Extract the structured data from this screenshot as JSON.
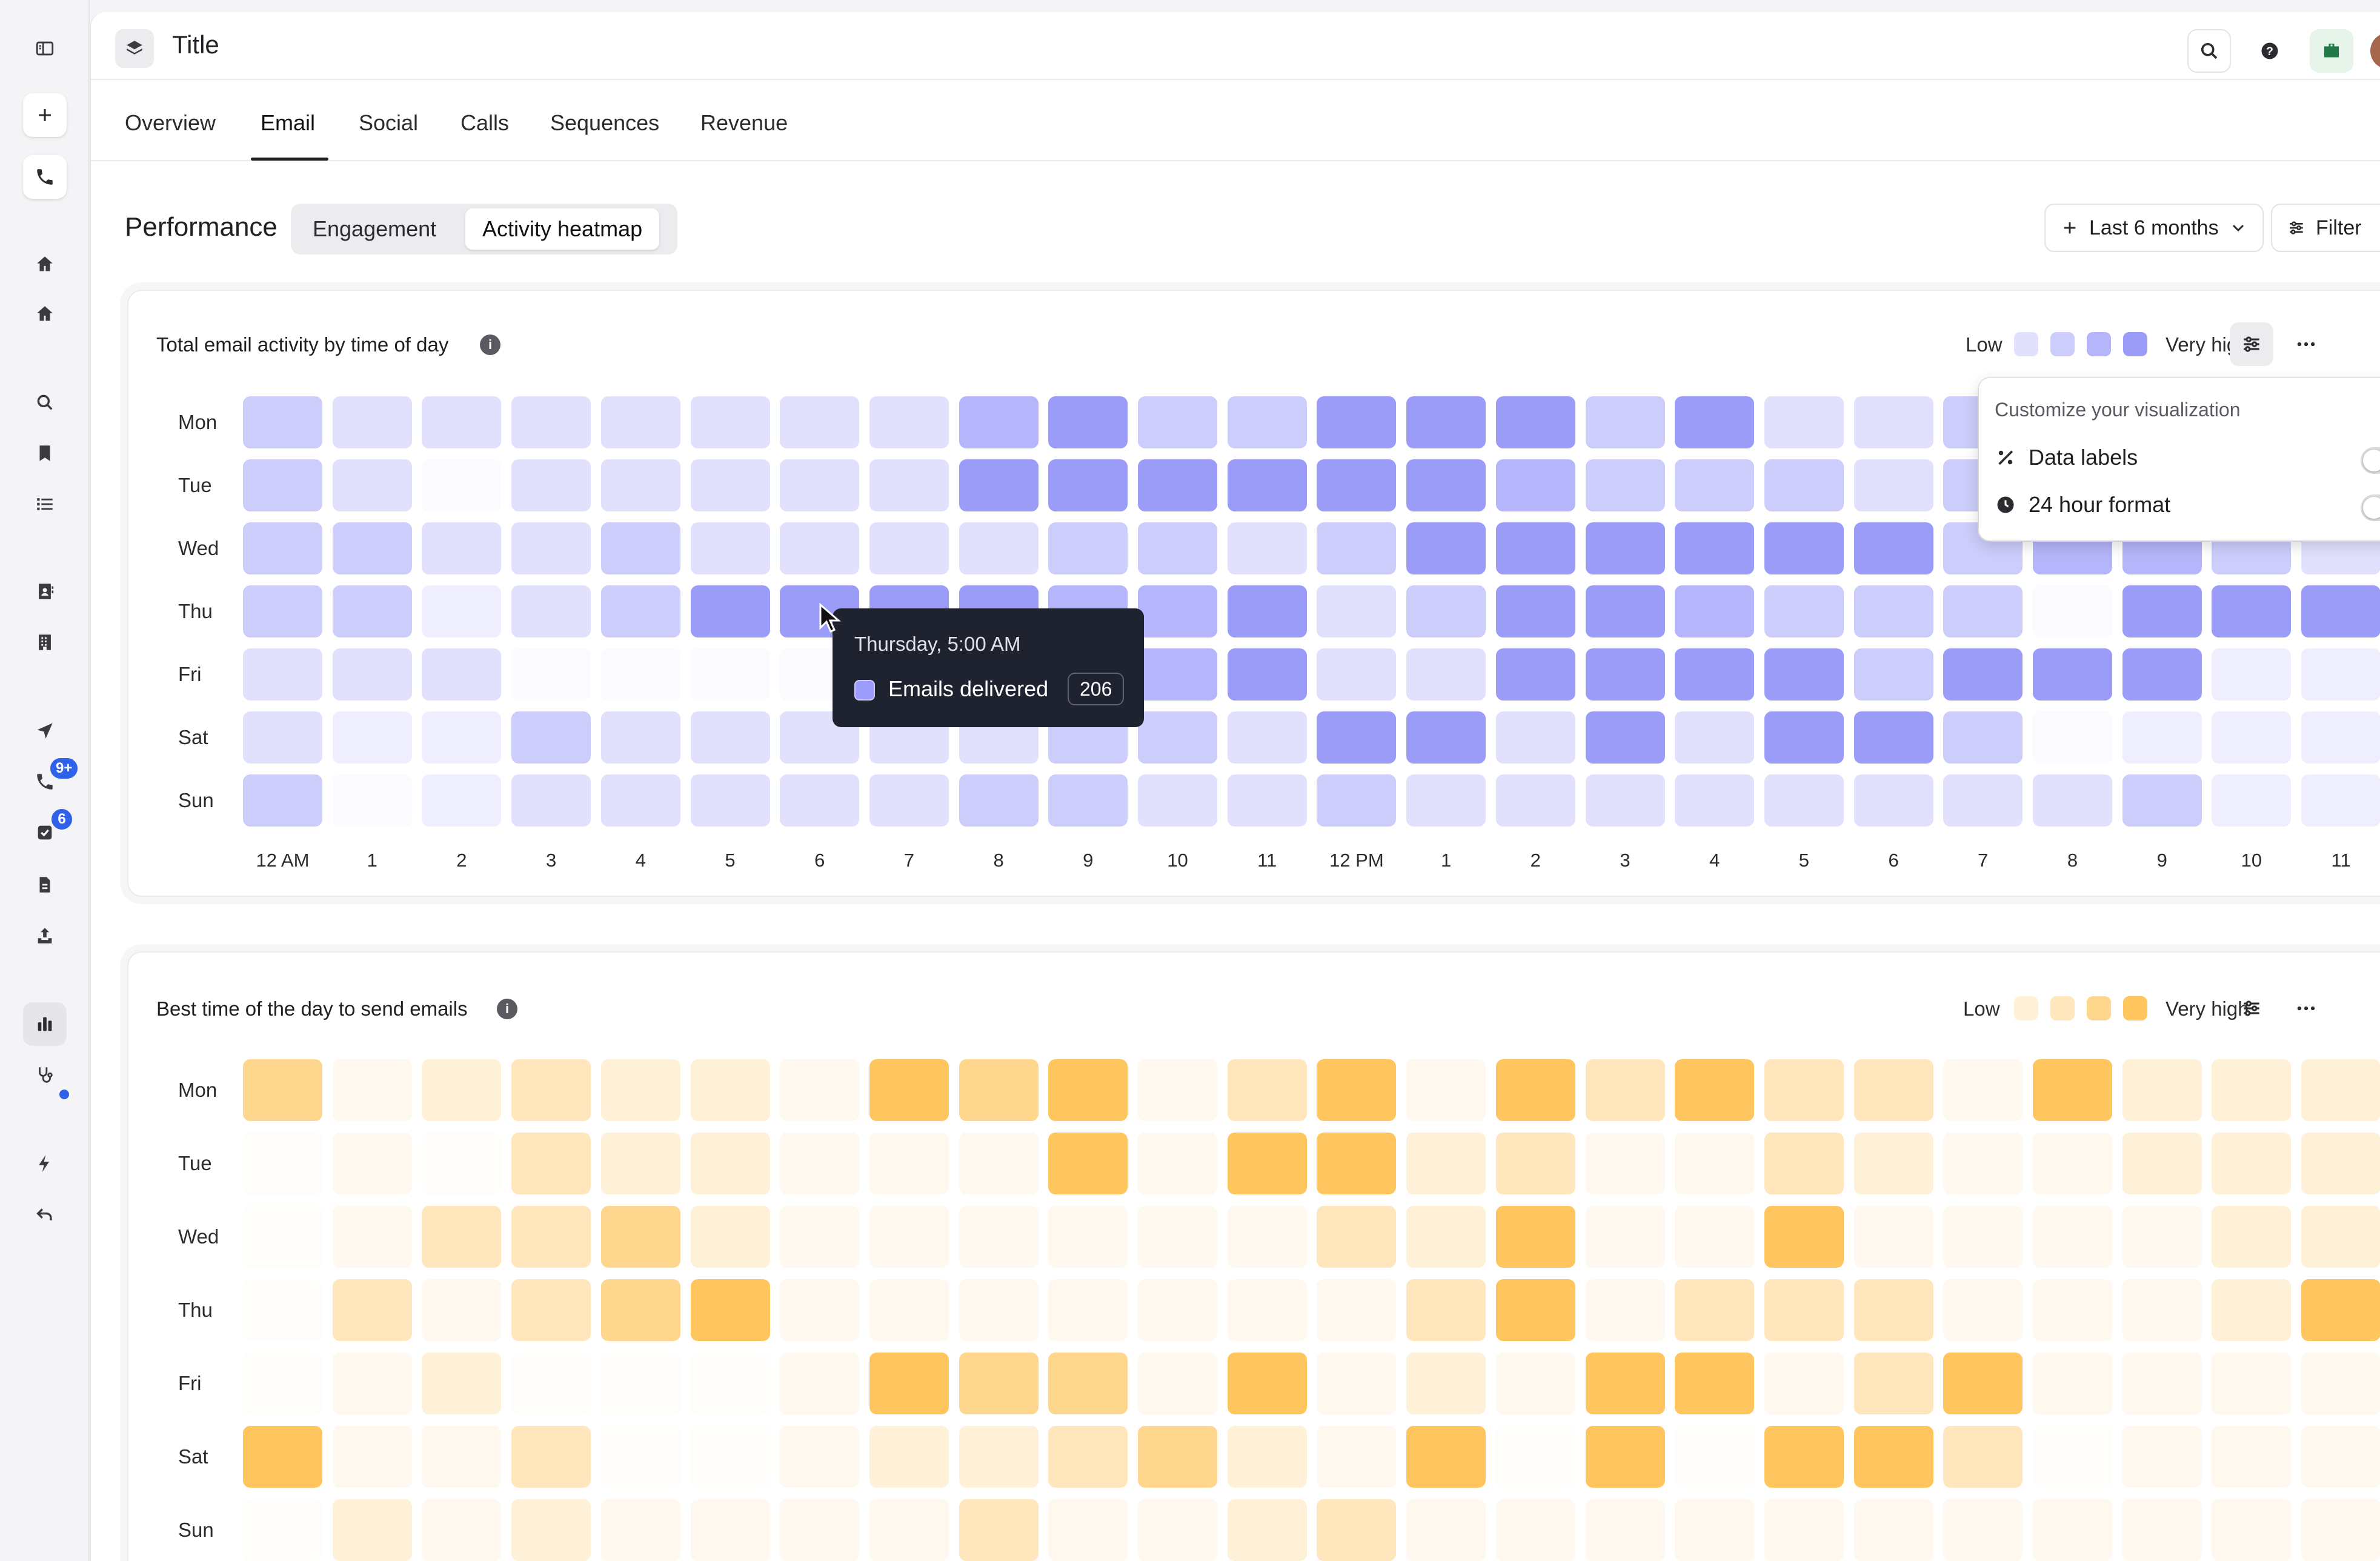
{
  "app": {
    "title": "Title"
  },
  "rail": {
    "badges": {
      "calls": "9+",
      "tasks": "6"
    }
  },
  "tabs": [
    {
      "label": "Overview"
    },
    {
      "label": "Email"
    },
    {
      "label": "Social"
    },
    {
      "label": "Calls"
    },
    {
      "label": "Sequences"
    },
    {
      "label": "Revenue"
    }
  ],
  "performance": {
    "title": "Performance",
    "segments": [
      {
        "label": "Engagement"
      },
      {
        "label": "Activity heatmap"
      }
    ],
    "date_range": "Last 6 months",
    "filter_label": "Filter"
  },
  "heatmap_common": {
    "days": [
      "Mon",
      "Tue",
      "Wed",
      "Thu",
      "Fri",
      "Sat",
      "Sun"
    ],
    "hours": [
      "12 AM",
      "1",
      "2",
      "3",
      "4",
      "5",
      "6",
      "7",
      "8",
      "9",
      "10",
      "11",
      "12 PM",
      "1",
      "2",
      "3",
      "4",
      "5",
      "6",
      "7",
      "8",
      "9",
      "10",
      "11"
    ]
  },
  "activity_card": {
    "title": "Total email activity by time of day",
    "legend_low": "Low",
    "legend_high": "Very high",
    "colors": [
      "#fafaff",
      "#eeeeff",
      "#e1e1fd",
      "#cdcdfc",
      "#b5b5fb",
      "#9b9bf8"
    ]
  },
  "best_time_card": {
    "title": "Best time of the day to send emails",
    "legend_low": "Low",
    "legend_high": "Very high",
    "colors": [
      "#fffdfa",
      "#fff8ee",
      "#fff0d8",
      "#ffe6bd",
      "#ffd68d",
      "#ffc55f"
    ]
  },
  "popover": {
    "title": "Customize your visualization",
    "options": [
      {
        "label": "Data labels",
        "on": false
      },
      {
        "label": "24 hour format",
        "on": false
      }
    ]
  },
  "tooltip": {
    "title": "Thursday, 5:00 AM",
    "series": "Emails delivered",
    "value": "206"
  },
  "chart_data": [
    {
      "type": "heatmap",
      "title": "Total email activity by time of day",
      "y": [
        "Mon",
        "Tue",
        "Wed",
        "Thu",
        "Fri",
        "Sat",
        "Sun"
      ],
      "x": [
        "12 AM",
        "1",
        "2",
        "3",
        "4",
        "5",
        "6",
        "7",
        "8",
        "9",
        "10",
        "11",
        "12 PM",
        "1",
        "2",
        "3",
        "4",
        "5",
        "6",
        "7",
        "8",
        "9",
        "10",
        "11"
      ],
      "scale": [
        "Low",
        "Very high"
      ],
      "levels": [
        [
          3,
          2,
          2,
          2,
          2,
          2,
          2,
          2,
          4,
          5,
          3,
          3,
          5,
          5,
          5,
          3,
          5,
          2,
          2,
          3,
          3,
          4,
          4,
          2
        ],
        [
          3,
          2,
          0,
          2,
          2,
          2,
          2,
          2,
          5,
          5,
          5,
          5,
          5,
          5,
          4,
          3,
          3,
          3,
          2,
          3,
          3,
          3,
          3,
          2
        ],
        [
          3,
          3,
          2,
          2,
          3,
          2,
          2,
          2,
          2,
          3,
          3,
          2,
          3,
          5,
          5,
          5,
          5,
          5,
          5,
          3,
          4,
          4,
          3,
          2
        ],
        [
          3,
          3,
          1,
          2,
          3,
          5,
          5,
          5,
          5,
          4,
          4,
          5,
          2,
          3,
          5,
          5,
          4,
          3,
          3,
          3,
          0,
          5,
          5,
          5
        ],
        [
          2,
          2,
          2,
          0,
          0,
          0,
          0,
          0,
          0,
          4,
          4,
          5,
          2,
          2,
          5,
          5,
          5,
          5,
          3,
          5,
          5,
          5,
          1,
          1
        ],
        [
          2,
          1,
          1,
          3,
          2,
          2,
          2,
          2,
          2,
          3,
          3,
          2,
          5,
          5,
          2,
          5,
          2,
          5,
          5,
          3,
          0,
          1,
          1,
          1
        ],
        [
          3,
          0,
          1,
          2,
          2,
          2,
          2,
          2,
          3,
          3,
          2,
          2,
          3,
          2,
          2,
          2,
          2,
          2,
          2,
          2,
          2,
          3,
          1,
          1
        ]
      ]
    },
    {
      "type": "heatmap",
      "title": "Best time of the day to send emails",
      "y": [
        "Mon",
        "Tue",
        "Wed",
        "Thu",
        "Fri",
        "Sat",
        "Sun"
      ],
      "x": [
        "12 AM",
        "1",
        "2",
        "3",
        "4",
        "5",
        "6",
        "7",
        "8",
        "9",
        "10",
        "11",
        "12 PM",
        "1",
        "2",
        "3",
        "4",
        "5",
        "6",
        "7",
        "8",
        "9",
        "10",
        "11"
      ],
      "scale": [
        "Low",
        "Very high"
      ],
      "levels": [
        [
          4,
          1,
          2,
          3,
          2,
          2,
          1,
          5,
          4,
          5,
          1,
          3,
          5,
          1,
          5,
          3,
          5,
          3,
          3,
          1,
          5,
          2,
          2,
          2
        ],
        [
          0,
          1,
          0,
          3,
          2,
          2,
          1,
          1,
          1,
          5,
          1,
          5,
          5,
          2,
          3,
          1,
          1,
          3,
          2,
          1,
          1,
          2,
          2,
          2
        ],
        [
          0,
          1,
          3,
          3,
          4,
          2,
          1,
          1,
          1,
          1,
          1,
          1,
          3,
          2,
          5,
          1,
          1,
          5,
          1,
          1,
          1,
          1,
          2,
          2
        ],
        [
          0,
          3,
          1,
          3,
          4,
          5,
          1,
          1,
          1,
          1,
          1,
          1,
          1,
          3,
          5,
          1,
          3,
          3,
          3,
          1,
          1,
          1,
          2,
          5
        ],
        [
          0,
          1,
          2,
          0,
          0,
          0,
          1,
          5,
          4,
          4,
          1,
          5,
          1,
          2,
          1,
          5,
          5,
          1,
          3,
          5,
          1,
          1,
          1,
          1
        ],
        [
          5,
          1,
          1,
          3,
          0,
          0,
          1,
          2,
          2,
          3,
          4,
          2,
          1,
          5,
          0,
          5,
          0,
          5,
          5,
          3,
          0,
          1,
          1,
          1
        ],
        [
          0,
          2,
          1,
          2,
          1,
          1,
          1,
          1,
          3,
          1,
          1,
          2,
          3,
          1,
          1,
          1,
          1,
          1,
          1,
          1,
          1,
          1,
          1,
          1
        ]
      ]
    }
  ]
}
